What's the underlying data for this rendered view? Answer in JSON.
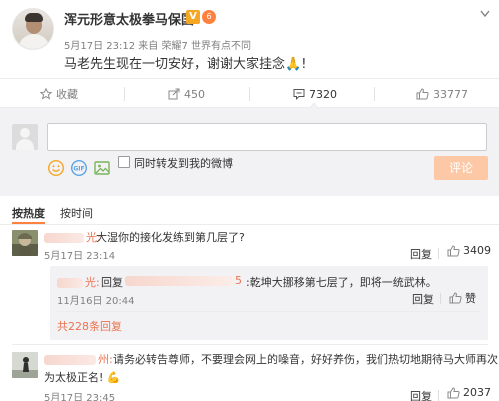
{
  "post": {
    "author": "浑元形意太极拳马保国",
    "vip_badge": "V",
    "level_badge": "6",
    "meta": "5月17日 23:12 来自 荣耀7 世界有点不同",
    "text": "马老先生现在一切安好，谢谢大家挂念",
    "text_emoji": "🙏",
    "text_end": "!"
  },
  "actions": {
    "favorite_label": "收藏",
    "repost_count": "450",
    "comment_count": "7320",
    "like_count": "33777"
  },
  "composer": {
    "input_value": "",
    "repost_label": "同时转发到我的微博",
    "submit_label": "评论"
  },
  "sort": {
    "hot_label": "按热度",
    "time_label": "按时间"
  },
  "comments": [
    {
      "name_suffix": "光:",
      "text": "大湿你的接化发练到第几层了?",
      "time": "5月17日 23:14",
      "reply_label": "回复",
      "like_count": "3409",
      "nested": {
        "name_suffix": "光:",
        "reply_prefix": "回复",
        "mention_suffix": "5",
        "text": ":乾坤大挪移第七层了，即将一统武林。",
        "time": "11月16日 20:44",
        "reply_label": "回复",
        "like_label": "赞"
      },
      "total_replies": "共228条回复"
    },
    {
      "name_suffix": "州:",
      "text_line1": "请务必转告尊师，不要理会网上的噪音，好好养伤，我们热切地期待马大师再次",
      "text_line2": "为太极正名!",
      "text_emoji": "💪",
      "time": "5月17日 23:45",
      "reply_label": "回复",
      "like_count": "2037"
    }
  ],
  "colors": {
    "accent": "#eb7350",
    "submit_disabled": "#fdc8a5",
    "composer_bg": "#f2f2f5",
    "vip": "#f5a623"
  }
}
